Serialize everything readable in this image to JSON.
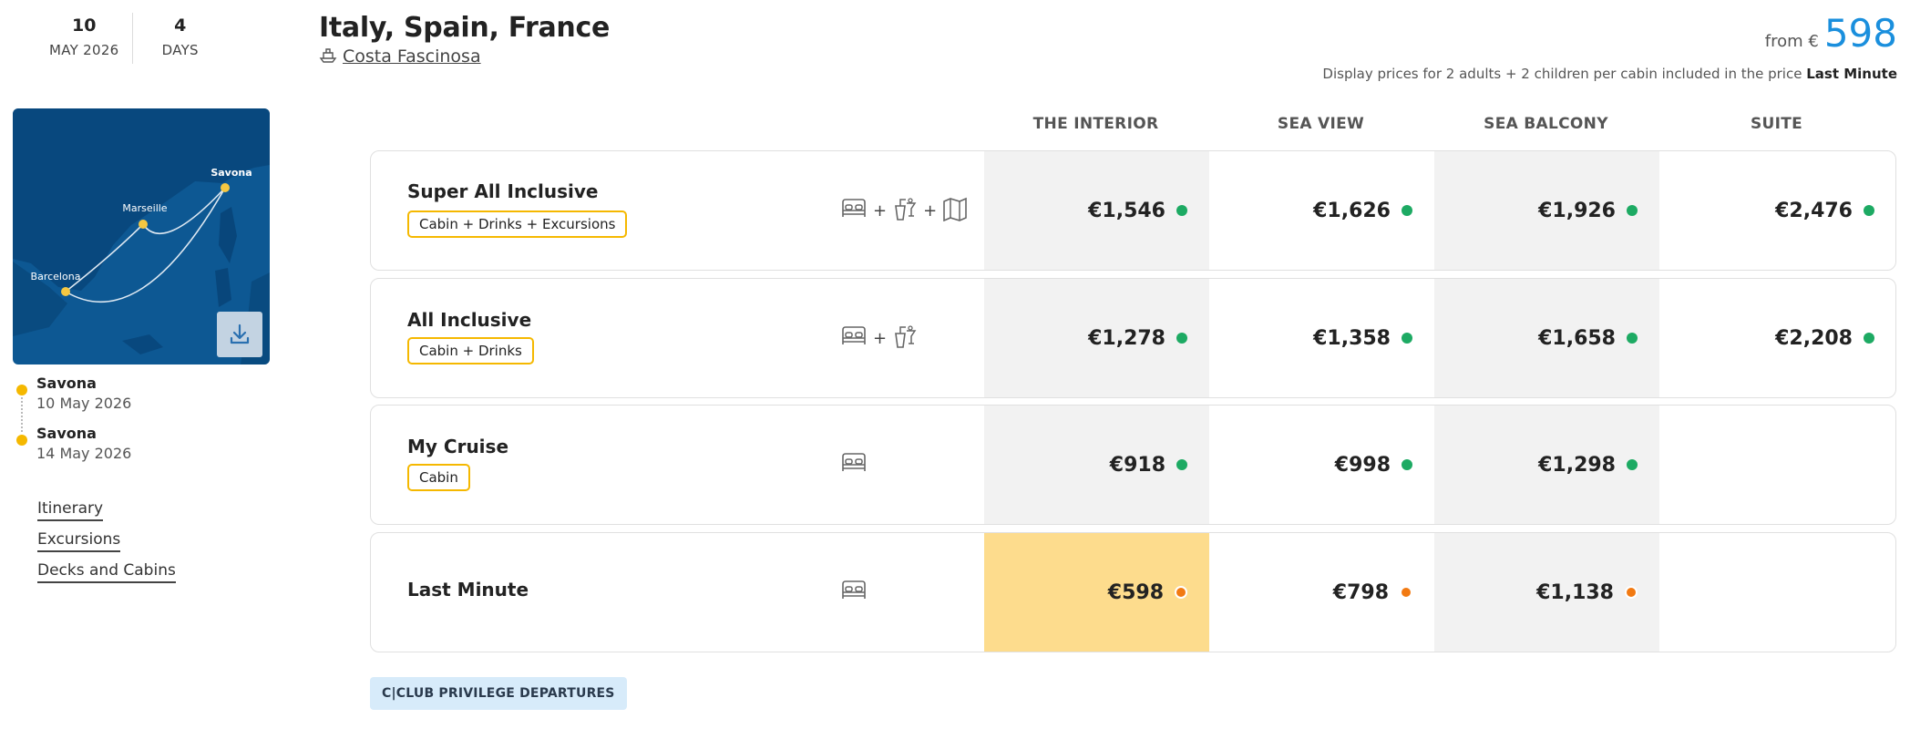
{
  "dates": {
    "start_day": "10",
    "start_month": "MAY 2026",
    "duration_value": "4",
    "duration_unit": "DAYS"
  },
  "map": {
    "ports": [
      "Savona",
      "Marseille",
      "Barcelona"
    ],
    "water_color": "#0d5893",
    "land_color": "#063d6e",
    "port_color": "#f5c842",
    "download_icon": "download-icon"
  },
  "route": {
    "stops": [
      {
        "name": "Savona",
        "date": "10 May 2026"
      },
      {
        "name": "Savona",
        "date": "14 May 2026"
      }
    ]
  },
  "links": [
    "Itinerary",
    "Excursions",
    "Decks and Cabins"
  ],
  "header": {
    "title": "Italy, Spain, France",
    "ship_name": "Costa Fascinosa",
    "ship_icon": "ship-icon",
    "from_label": "from €",
    "from_value": "598",
    "note_prefix": "Display prices for 2 adults + 2 children per cabin included in the price",
    "note_bold": "Last Minute"
  },
  "table": {
    "columns": [
      "THE INTERIOR",
      "SEA VIEW",
      "SEA BALCONY",
      "SUITE"
    ],
    "rows": [
      {
        "name": "Super All Inclusive",
        "badge": "Cabin + Drinks + Excursions",
        "icons": [
          "bed-icon",
          "drinks-icon",
          "map-icon"
        ],
        "plus": "+",
        "prices": [
          "€1,546",
          "€1,626",
          "€1,926",
          "€2,476"
        ],
        "availability": [
          "green",
          "green",
          "green",
          "green"
        ]
      },
      {
        "name": "All Inclusive",
        "badge": "Cabin + Drinks",
        "icons": [
          "bed-icon",
          "drinks-icon"
        ],
        "plus": "+",
        "prices": [
          "€1,278",
          "€1,358",
          "€1,658",
          "€2,208"
        ],
        "availability": [
          "green",
          "green",
          "green",
          "green"
        ]
      },
      {
        "name": "My Cruise",
        "badge": "Cabin",
        "icons": [
          "bed-icon"
        ],
        "prices": [
          "€918",
          "€998",
          "€1,298",
          ""
        ],
        "availability": [
          "green",
          "green",
          "green",
          ""
        ]
      },
      {
        "name": "Last Minute",
        "badge": "",
        "icons": [
          "bed-icon"
        ],
        "prices": [
          "€598",
          "€798",
          "€1,138",
          ""
        ],
        "availability": [
          "orange",
          "orange",
          "orange",
          ""
        ],
        "highlight_index": 0
      }
    ]
  },
  "colors": {
    "accent_blue": "#1a8fdd",
    "badge_border": "#f5b800",
    "available_green": "#1daa63",
    "limited_orange": "#f27a12",
    "highlight_yellow": "#fddc8d"
  },
  "club_button": "C|CLUB PRIVILEGE DEPARTURES"
}
